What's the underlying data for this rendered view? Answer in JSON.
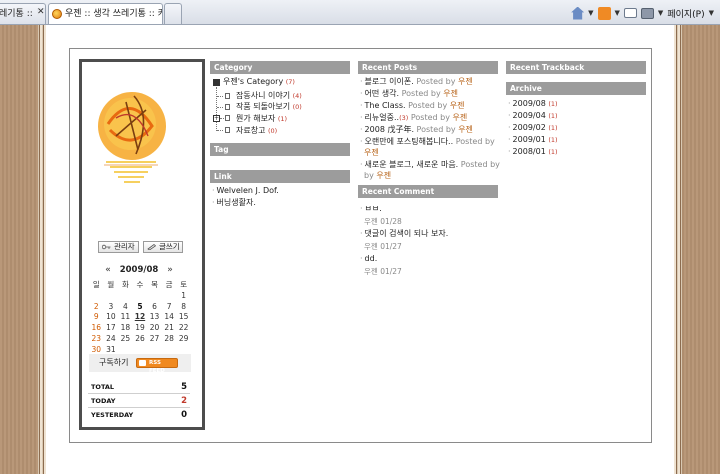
{
  "browser": {
    "tab1_label": "레기통 ::",
    "tab2_label": "우젠 :: 생각 쓰레기통 :: 카...",
    "close_glyph": "✕",
    "page_menu_label": "페이지(P)",
    "dropdown_glyph": "▼"
  },
  "profile": {
    "admin_button": "관리자",
    "write_button": "글쓰기",
    "calendar": {
      "title": "2009/08",
      "prev": "«",
      "next": "»",
      "weekdays": [
        "일",
        "월",
        "화",
        "수",
        "목",
        "금",
        "토"
      ],
      "weeks": [
        [
          "",
          "",
          "",
          "",
          "",
          "",
          "1"
        ],
        [
          "2",
          "3",
          "4",
          "5",
          "6",
          "7",
          "8"
        ],
        [
          "9",
          "10",
          "11",
          "12",
          "13",
          "14",
          "15"
        ],
        [
          "16",
          "17",
          "18",
          "19",
          "20",
          "21",
          "22"
        ],
        [
          "23",
          "24",
          "25",
          "26",
          "27",
          "28",
          "29"
        ],
        [
          "30",
          "31",
          "",
          "",
          "",
          "",
          ""
        ]
      ]
    },
    "subscribe_label": "구독하기",
    "rss_label": "RSS FEED",
    "counters": [
      {
        "label": "TOTAL",
        "value": "5"
      },
      {
        "label": "TODAY",
        "value": "2"
      },
      {
        "label": "YESTERDAY",
        "value": "0"
      }
    ]
  },
  "category": {
    "title": "Category",
    "root": {
      "label": "우젠's Category",
      "count": "(7)"
    },
    "items": [
      {
        "label": "잡동사니 이야기",
        "count": "(4)"
      },
      {
        "label": "작품 되돌아보기",
        "count": "(0)"
      },
      {
        "label": "뭔가 해보자",
        "count": "(1)"
      },
      {
        "label": "자료창고",
        "count": "(0)"
      }
    ]
  },
  "tag": {
    "title": "Tag"
  },
  "link": {
    "title": "Link",
    "items": [
      "Welvelen J. Dof.",
      "버닝생활자."
    ]
  },
  "recent_posts": {
    "title": "Recent Posts",
    "posted_by": "Posted by",
    "author": "우젠",
    "items": [
      {
        "title": "블로그 이이폰."
      },
      {
        "title": "어떤 생각."
      },
      {
        "title": "The Class."
      },
      {
        "title": "리뉴얼중..",
        "count": "(3)"
      },
      {
        "title": "2008 戊子年."
      },
      {
        "title": "오랜만에 포스팅해봅니다.."
      },
      {
        "title": "새로운 블로그, 새로운 마음."
      }
    ]
  },
  "recent_comment": {
    "title": "Recent Comment",
    "items": [
      {
        "text": "ㅂㅂ.",
        "author": "우젠",
        "date": "01/28"
      },
      {
        "text": "댓글이 검색이 되나 보자.",
        "author": "우젠",
        "date": "01/27"
      },
      {
        "text": "dd.",
        "author": "우젠",
        "date": "01/27"
      }
    ]
  },
  "recent_trackback": {
    "title": "Recent Trackback"
  },
  "archive": {
    "title": "Archive",
    "items": [
      {
        "label": "2009/08",
        "count": "(1)"
      },
      {
        "label": "2009/04",
        "count": "(1)"
      },
      {
        "label": "2009/02",
        "count": "(1)"
      },
      {
        "label": "2009/01",
        "count": "(1)"
      },
      {
        "label": "2008/01",
        "count": "(1)"
      }
    ]
  }
}
